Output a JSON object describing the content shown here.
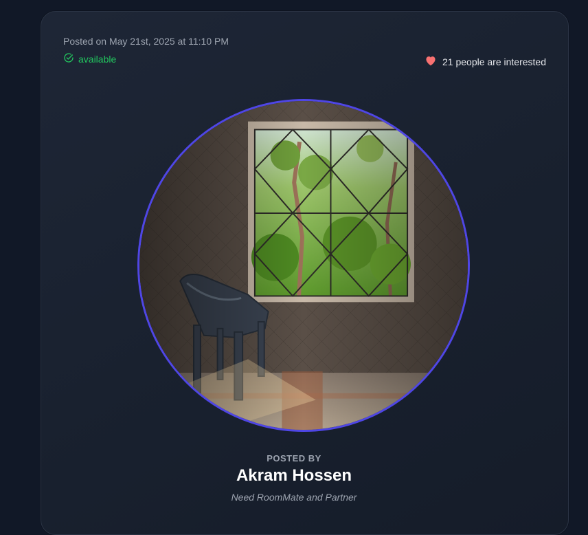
{
  "post": {
    "posted_on": "Posted on May 21st, 2025 at 11:10 PM",
    "status": "available",
    "interest": "21 people are interested",
    "posted_by_label": "POSTED BY",
    "author_name": "Akram Hossen",
    "tagline": "Need RoomMate and Partner"
  },
  "colors": {
    "background": "#111827",
    "available": "#22c55e",
    "heart": "#f87171",
    "photo_ring": "#4f46e5"
  },
  "icons": {
    "status": "check-circle-icon",
    "interest": "heart-icon"
  }
}
